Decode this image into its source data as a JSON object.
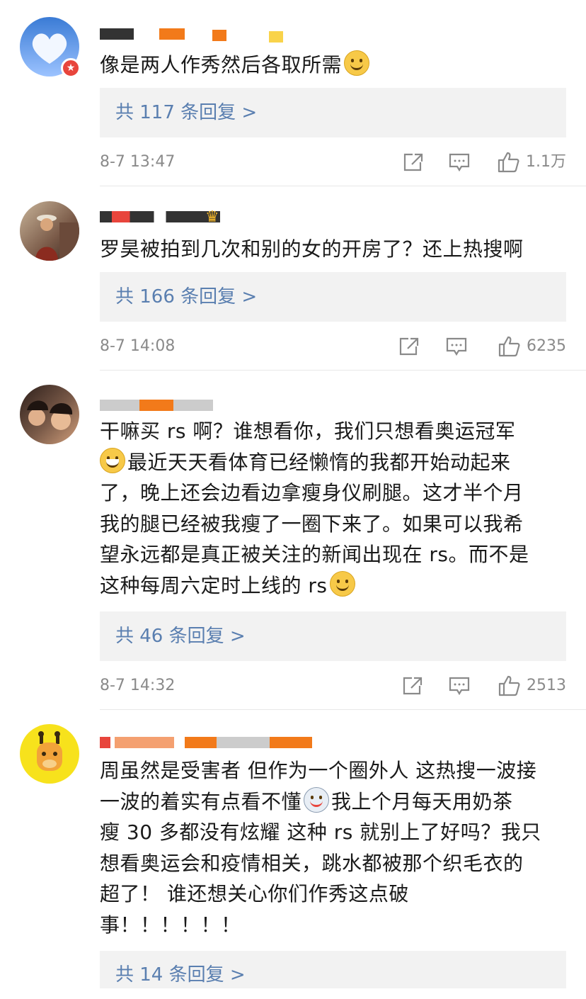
{
  "comments": [
    {
      "text_before": "像是两人作秀然后各取所需",
      "emoji_after": "doge-emoji",
      "replies": "共 117 条回复 >",
      "time": "8-7 13:47",
      "likes": "1.1万"
    },
    {
      "text": "罗昊被拍到几次和别的女的开房了？还上热搜啊",
      "replies": "共 166 条回复 >",
      "time": "8-7 14:08",
      "likes": "6235"
    },
    {
      "line1": "干嘛买 rs 啊？谁想看你，我们只想看奥运冠军",
      "line2": "最近天天看体育已经懒惰的我都开始动起来",
      "line3": "了，晚上还会边看边拿瘦身仪刷腿。这才半个月",
      "line4": "我的腿已经被我瘦了一圈下来了。如果可以我希",
      "line5": "望永远都是真正被关注的新闻出现在 rs。而不是",
      "line6": "这种每周六定时上线的 rs",
      "replies": "共 46 条回复 >",
      "time": "8-7 14:32",
      "likes": "2513"
    },
    {
      "line1": "周虽然是受害者 但作为一个圈外人 这热搜一波接",
      "line2a": "一波的着实有点看不懂",
      "line2b": "我上个月每天用奶茶",
      "line3": "瘦 30 多都没有炫耀 这种 rs 就别上了好吗？我只",
      "line4": "想看奥运会和疫情相关，跳水都被那个织毛衣的",
      "line5": "超了！ 谁还想关心你们作秀这点破",
      "line6": "事！！！！！！",
      "replies": "共 14 条回复 >"
    }
  ],
  "colors": {
    "link": "#5a7fb0",
    "meta": "#8a8a8a",
    "reply_bg": "#f2f2f2"
  }
}
